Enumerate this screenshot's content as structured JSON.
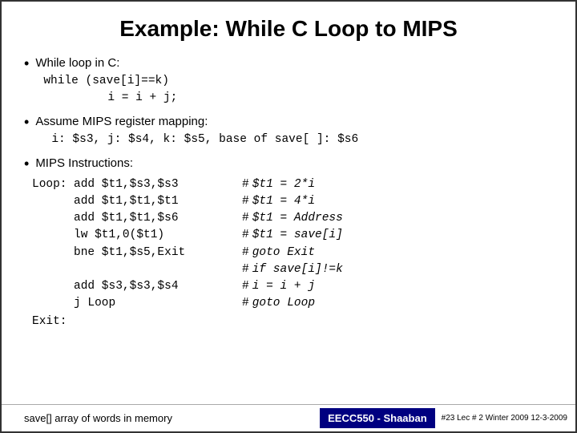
{
  "slide": {
    "title": "Example: While C Loop to MIPS",
    "bullet1_prefix": "While loop in C:",
    "while_code_line1": "while (save[i]==k)",
    "while_code_line2": "i = i + j;",
    "bullet2_prefix": "Assume MIPS register mapping:",
    "register_mapping": "i: $s3,  j: $s4,  k: $s5,  base of save[ ]: $s6",
    "bullet3_prefix": "MIPS Instructions:",
    "loop_label": "Loop:",
    "instructions": [
      {
        "label": "Loop:",
        "instr": "add  $t1,$s3,$s3",
        "comment": "$t1 = 2*i"
      },
      {
        "label": "",
        "instr": "add  $t1,$t1,$t1",
        "comment": "$t1 = 4*i"
      },
      {
        "label": "",
        "instr": "add  $t1,$t1,$s6",
        "comment": "$t1 = Address"
      },
      {
        "label": "",
        "instr": "lw   $t1,0($t1)",
        "comment": "$t1 = save[i]"
      },
      {
        "label": "",
        "instr": "bne  $t1,$s5,Exit",
        "comment": "goto Exit"
      },
      {
        "label": "",
        "instr": "",
        "comment": "if save[i]!=k"
      },
      {
        "label": "",
        "instr": "add  $s3,$s3,$s4",
        "comment": "i = i + j"
      },
      {
        "label": "",
        "instr": "j    Loop",
        "comment": "goto Loop"
      }
    ],
    "exit_label": "Exit:",
    "footer_left": "save[] array of words in memory",
    "footer_brand": "EECC550 - Shaaban",
    "footer_sub": "#23  Lec # 2  Winter 2009  12-3-2009"
  }
}
